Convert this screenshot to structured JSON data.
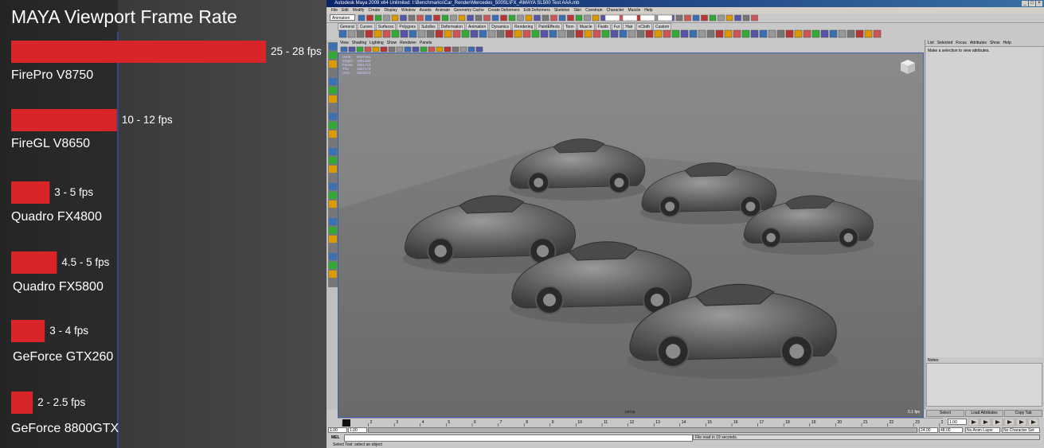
{
  "chart_data": {
    "type": "bar",
    "orientation": "horizontal",
    "title": "MAYA Viewport Frame Rate",
    "categories": [
      "FirePro V8750",
      "FireGL V8650",
      "Quadro FX4800",
      "Quadro FX5800",
      "GeForce GTX260",
      "GeForce 8800GTX"
    ],
    "values": [
      26.5,
      11,
      4,
      4.75,
      3.5,
      2.25
    ],
    "value_labels": [
      "25 - 28 fps",
      "10 - 12 fps",
      "3 - 5 fps",
      "4.5 - 5 fps",
      "3 - 4 fps",
      "2 - 2.5 fps"
    ],
    "xlim": [
      0,
      30
    ],
    "bar_color": "#d9252a",
    "grid": false,
    "legend": "none"
  },
  "maya": {
    "window_title": "Autodesk Maya 2009 x64 Unlimited: I:\\Benchmarks\\Car_Render\\Mercedes_500SL\\FX_4\\MAYA SL500 Test AAA.mb",
    "menus": [
      "File",
      "Edit",
      "Modify",
      "Create",
      "Display",
      "Window",
      "Assets",
      "Animate",
      "Geometry Cache",
      "Create Deformers",
      "Edit Deformers",
      "Skeleton",
      "Skin",
      "Constrain",
      "Character",
      "Muscle",
      "Help"
    ],
    "mode": "Animation",
    "shelf_tabs": [
      "General",
      "Curves",
      "Surfaces",
      "Polygons",
      "Subdivs",
      "Deformation",
      "Animation",
      "Dynamics",
      "Rendering",
      "PaintEffects",
      "Toon",
      "Muscle",
      "Fluids",
      "Fur",
      "Hair",
      "nCloth",
      "Custom"
    ],
    "panel_menus": [
      "View",
      "Shading",
      "Lighting",
      "Show",
      "Renderer",
      "Panels"
    ],
    "hud": [
      {
        "label": "Verts:",
        "value": "0427481"
      },
      {
        "label": "Edges:",
        "value": "1891356"
      },
      {
        "label": "Faces:",
        "value": "1051713"
      },
      {
        "label": "Tris:",
        "value": "1867172"
      },
      {
        "label": "UVs:",
        "value": "1903574"
      }
    ],
    "camera_label": "persp",
    "fps_readout": "0.1 fps",
    "attr_menus": [
      "List",
      "Selected",
      "Focus",
      "Attributes",
      "Show",
      "Help"
    ],
    "attr_message": "Make a selection to view attributes.",
    "notes_label": "Notes:",
    "attr_buttons": [
      "Select",
      "Load Attributes",
      "Copy Tab"
    ],
    "time_ticks": [
      "1",
      "2",
      "3",
      "4",
      "5",
      "6",
      "7",
      "8",
      "9",
      "10",
      "11",
      "12",
      "13",
      "14",
      "15",
      "16",
      "17",
      "18",
      "19",
      "20",
      "21",
      "22",
      "23",
      "24"
    ],
    "current_frame": "1.00",
    "range_start": "1.00",
    "range_start_inner": "1.00",
    "range_end_inner": "24.00",
    "range_end": "48.00",
    "anim_layer": "No Anim Layer",
    "char_set": "No Character Set",
    "mel_label": "MEL",
    "result_text": "File read in  19 seconds.",
    "help_text": "Select Tool: select an object"
  }
}
